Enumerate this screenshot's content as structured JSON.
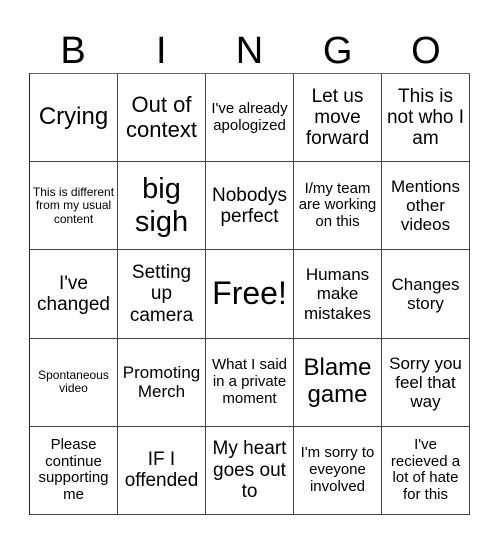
{
  "header": {
    "letters": [
      "B",
      "I",
      "N",
      "G",
      "O"
    ]
  },
  "cells": [
    "Crying",
    "Out of context",
    "I've already apologized",
    "Let us move forward",
    "This is not who I am",
    "This is different from my usual content",
    "big sigh",
    "Nobodys perfect",
    "I/my team are working on this",
    "Mentions other videos",
    "I've changed",
    "Setting up camera",
    "Free!",
    "Humans make mistakes",
    "Changes story",
    "Spontaneous video",
    "Promoting Merch",
    "What I said in a private moment",
    "Blame game",
    "Sorry you feel that way",
    "Please continue supporting me",
    "IF I offended",
    "My heart goes out to",
    "I'm sorry to eveyone involved",
    "I've recieved a lot of hate for this"
  ]
}
